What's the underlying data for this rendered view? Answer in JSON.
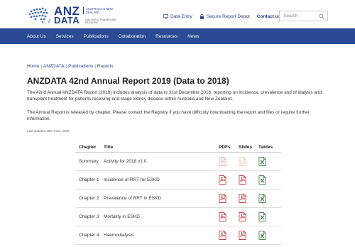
{
  "header": {
    "logo": {
      "line1": "ANZ",
      "line2": "DATA",
      "sub": "AUSTRALIA & NEW ZEALAND",
      "sub2": "DIALYSIS & TRANSPLANT REGISTRY"
    },
    "links": {
      "data_entry": "Data Entry",
      "secure": "Secure Report Depot",
      "contact": "Contact us"
    },
    "search_placeholder": "Search"
  },
  "nav": {
    "items": [
      "About Us",
      "Services",
      "Publications",
      "Collaboration",
      "Resources",
      "News"
    ]
  },
  "breadcrumb": [
    "Home",
    "ANZDATA",
    "Publications",
    "Reports"
  ],
  "page": {
    "title": "ANZDATA 42nd Annual Report 2019 (Data to 2018)",
    "para1": "The 42nd Annual ANZDATA Report (2019) includes analysis of data to 31st December 2018, reporting on incidence, prevalence and of dialysis and transplant treatment for patients receiving end-stage kidney disease within Australia and New Zealand.",
    "para2": "The Annual Report is released by chapter. Please contact the Registry if you have difficulty downloading the report and files or require further information.",
    "updated": "Last updated 10th June, 2020"
  },
  "table": {
    "headers": {
      "chapter": "Chapter",
      "title": "Title",
      "pdfs": "PDFs",
      "slides": "Slides",
      "tables": "Tables"
    },
    "rows": [
      {
        "chapter": "Summary",
        "title": "Activity for 2018 v1.0",
        "muted": true
      },
      {
        "chapter": "Chapter 1",
        "title": "Incidence of RRT for ESKD",
        "muted": false
      },
      {
        "chapter": "Chapter 2",
        "title": "Prevalence of RRT in ESKD",
        "muted": false
      },
      {
        "chapter": "Chapter 3",
        "title": "Mortality in ESKD",
        "muted": false
      },
      {
        "chapter": "Chapter 4",
        "title": "Haemodialysis",
        "muted": false
      }
    ]
  },
  "colors": {
    "brand": "#1e3f87",
    "nav": "#2a4a93",
    "pdf": "#c62828",
    "pdf_muted": "#f0a8a0",
    "slides_muted": "#f4c7a6",
    "xls": "#2e7d32"
  }
}
